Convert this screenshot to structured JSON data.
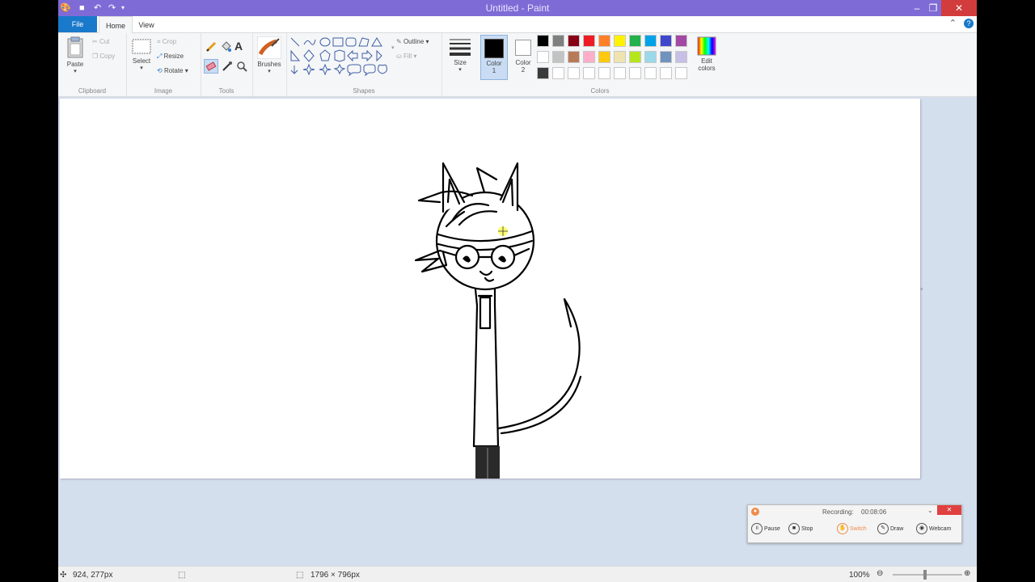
{
  "window": {
    "title": "Untitled - Paint",
    "controls": {
      "minimize": "–",
      "maximize": "❐",
      "close": "✕"
    }
  },
  "tabs": {
    "file": "File",
    "home": "Home",
    "view": "View"
  },
  "ribbon": {
    "clipboard": {
      "label": "Clipboard",
      "paste": "Paste",
      "cut": "Cut",
      "copy": "Copy"
    },
    "image": {
      "label": "Image",
      "select": "Select",
      "crop": "Crop",
      "resize": "Resize",
      "rotate": "Rotate"
    },
    "tools": {
      "label": "Tools"
    },
    "brushes": {
      "label": "Brushes"
    },
    "shapes": {
      "label": "Shapes",
      "outline": "Outline",
      "fill": "Fill"
    },
    "size": {
      "label": "Size"
    },
    "colors": {
      "label": "Colors",
      "color1": "Color",
      "color1_num": "1",
      "color2": "Color",
      "color2_num": "2",
      "edit": "Edit",
      "edit2": "colors",
      "color1_value": "#000000",
      "color2_value": "#ffffff",
      "palette_row1": [
        "#000000",
        "#7f7f7f",
        "#880015",
        "#ed1c24",
        "#ff7f27",
        "#fff200",
        "#22b14c",
        "#00a2e8",
        "#3f48cc",
        "#a349a4"
      ],
      "palette_row2": [
        "#ffffff",
        "#c3c3c3",
        "#b97a57",
        "#ffaec9",
        "#ffc90e",
        "#efe4b0",
        "#b5e61d",
        "#99d9ea",
        "#7092be",
        "#c8bfe7"
      ],
      "palette_row3": [
        "#3a3a3a",
        "#ffffff",
        "#ffffff",
        "#ffffff",
        "#ffffff",
        "#ffffff",
        "#ffffff",
        "#ffffff",
        "#ffffff",
        "#ffffff"
      ]
    }
  },
  "status": {
    "cursor_pos": "924, 277px",
    "image_size": "1796 × 796px",
    "zoom": "100%"
  },
  "recorder": {
    "status": "Recording:",
    "time": "00:08:06",
    "pause": "Pause",
    "stop": "Stop",
    "switch": "Switch",
    "draw": "Draw",
    "webcam": "Webcam"
  }
}
